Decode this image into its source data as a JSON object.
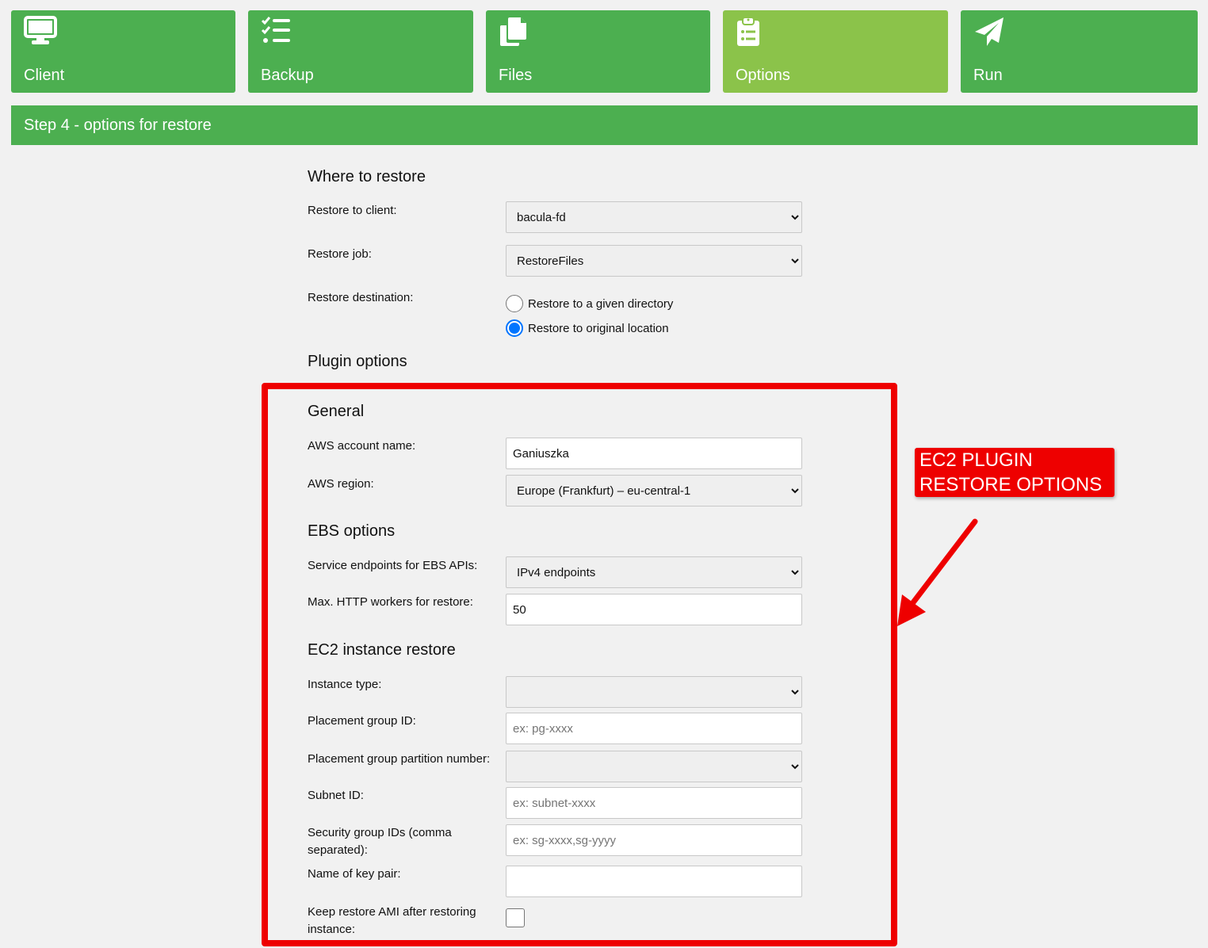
{
  "tabs": [
    {
      "label": "Client",
      "icon": "monitor-icon",
      "active": false
    },
    {
      "label": "Backup",
      "icon": "checklist-icon",
      "active": false
    },
    {
      "label": "Files",
      "icon": "copy-files-icon",
      "active": false
    },
    {
      "label": "Options",
      "icon": "clipboard-list-icon",
      "active": true
    },
    {
      "label": "Run",
      "icon": "paper-plane-icon",
      "active": false
    }
  ],
  "step_title": "Step 4 - options for restore",
  "where": {
    "heading": "Where to restore",
    "client_label": "Restore to client:",
    "client_value": "bacula-fd",
    "job_label": "Restore job:",
    "job_value": "RestoreFiles",
    "destination_label": "Restore destination:",
    "destination_options": [
      {
        "label": "Restore to a given directory",
        "checked": false
      },
      {
        "label": "Restore to original location",
        "checked": true
      }
    ]
  },
  "plugin_heading": "Plugin options",
  "general": {
    "heading": "General",
    "account_label": "AWS account name:",
    "account_value": "Ganiuszka",
    "region_label": "AWS region:",
    "region_value": "Europe (Frankfurt) – eu-central-1"
  },
  "ebs": {
    "heading": "EBS options",
    "endpoints_label": "Service endpoints for EBS APIs:",
    "endpoints_value": "IPv4 endpoints",
    "workers_label": "Max. HTTP workers for restore:",
    "workers_value": "50"
  },
  "ec2": {
    "heading": "EC2 instance restore",
    "instance_type_label": "Instance type:",
    "instance_type_value": "",
    "placement_group_label": "Placement group ID:",
    "placement_group_placeholder": "ex: pg-xxxx",
    "partition_label": "Placement group partition number:",
    "partition_value": "",
    "subnet_label": "Subnet ID:",
    "subnet_placeholder": "ex: subnet-xxxx",
    "security_label": "Security group IDs (comma separated):",
    "security_placeholder": "ex: sg-xxxx,sg-yyyy",
    "keypair_label": "Name of key pair:",
    "keypair_value": "",
    "keep_ami_label": "Keep restore AMI after restoring instance:",
    "keep_ami_checked": false
  },
  "annotation": {
    "text": "EC2 PLUGIN RESTORE OPTIONS",
    "color": "#ee0000"
  },
  "colors": {
    "tab_green": "#4caf50",
    "tab_active": "#8bc34a",
    "radio_blue": "#0075ff"
  }
}
